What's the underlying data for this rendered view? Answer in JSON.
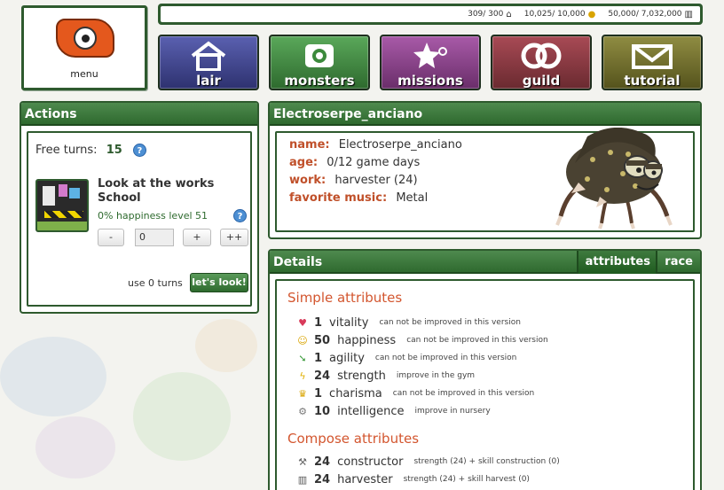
{
  "menu": {
    "label": "menu"
  },
  "resources": {
    "population": "309/ 300",
    "money": "10,025/ 10,000",
    "storage": "50,000/ 7,032,000"
  },
  "nav": [
    {
      "label": "lair",
      "icon": "house-icon",
      "color": "#3b3f8c"
    },
    {
      "label": "monsters",
      "icon": "eye-icon",
      "color": "#3c8a3c"
    },
    {
      "label": "missions",
      "icon": "stars-icon",
      "color": "#8a3d8a"
    },
    {
      "label": "guild",
      "icon": "rings-icon",
      "color": "#8a2f38"
    },
    {
      "label": "tutorial",
      "icon": "envelope-icon",
      "color": "#6f6d2a"
    }
  ],
  "actions": {
    "title": "Actions",
    "free_turns_label": "Free turns:",
    "free_turns_value": "15",
    "task_title": "Look at the works School",
    "task_info": "0% happiness level 51",
    "minus_label": "-",
    "quantity_value": "0",
    "plus_label": "+",
    "plus_plus_label": "++",
    "use_turns": "use 0 turns",
    "submit_label": "let's look!"
  },
  "monster": {
    "title": "Electroserpe_anciano",
    "name_key": "name:",
    "name_value": "Electroserpe_anciano",
    "age_key": "age:",
    "age_value": "0/12 game days",
    "work_key": "work:",
    "work_value": "harvester (24)",
    "music_key": "favorite music:",
    "music_value": "Metal"
  },
  "details": {
    "title": "Details",
    "tabs": [
      "attributes",
      "race"
    ],
    "simple_title": "Simple attributes",
    "simple": [
      {
        "icon": "heart-icon",
        "value": "1",
        "name": "vitality",
        "note": "can not be improved in this version"
      },
      {
        "icon": "smiley-icon",
        "value": "50",
        "name": "happiness",
        "note": "can not be improved in this version"
      },
      {
        "icon": "arrow-icon",
        "value": "1",
        "name": "agility",
        "note": "can not be improved in this version"
      },
      {
        "icon": "lightning-icon",
        "value": "24",
        "name": "strength",
        "note": "improve in the gym"
      },
      {
        "icon": "crown-icon",
        "value": "1",
        "name": "charisma",
        "note": "can not be improved in this version"
      },
      {
        "icon": "gear-icon",
        "value": "10",
        "name": "intelligence",
        "note": "improve in nursery"
      }
    ],
    "compose_title": "Compose attributes",
    "compose": [
      {
        "icon": "wrench-icon",
        "value": "24",
        "name": "constructor",
        "note": "strength (24) + skill construction (0)"
      },
      {
        "icon": "bank-icon",
        "value": "24",
        "name": "harvester",
        "note": "strength (24) + skill harvest (0)"
      }
    ]
  }
}
